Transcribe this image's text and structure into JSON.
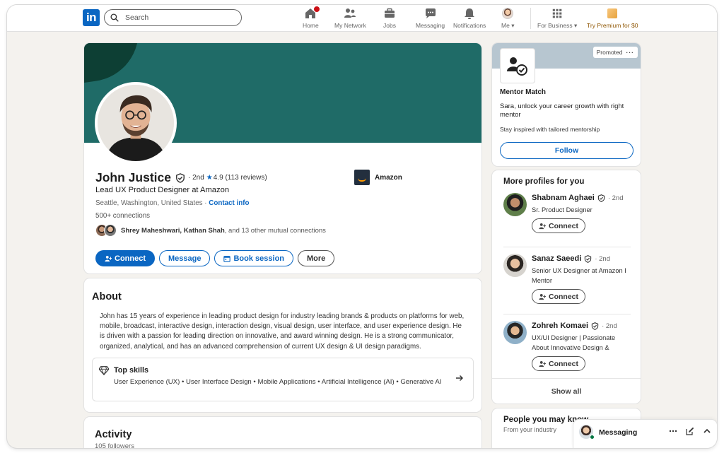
{
  "nav": {
    "search_placeholder": "Search",
    "items": [
      {
        "label": "Home",
        "icon": "home-icon"
      },
      {
        "label": "My Network",
        "icon": "network-icon"
      },
      {
        "label": "Jobs",
        "icon": "briefcase-icon"
      },
      {
        "label": "Messaging",
        "icon": "chat-icon"
      },
      {
        "label": "Notifications",
        "icon": "bell-icon"
      },
      {
        "label": "Me",
        "icon": "avatar"
      },
      {
        "label": "For Business",
        "icon": "grid-icon"
      },
      {
        "label": "Try Premium for $0",
        "icon": "premium-icon"
      }
    ]
  },
  "profile": {
    "name": "John Justice",
    "degree": "· 2nd",
    "rating": "4.9",
    "reviews": "(113 reviews)",
    "headline": "Lead UX Product Designer at Amazon",
    "location": "Seattle, Washington, United States ·",
    "contact_link": "Contact info",
    "connections": "500+ connections",
    "mutual_names": "Shrey Maheshwari, Kathan Shah",
    "mutual_rest": ", and 13 other mutual connections",
    "company": "Amazon",
    "buttons": {
      "connect": "Connect",
      "message": "Message",
      "book": "Book session",
      "more": "More"
    }
  },
  "about": {
    "title": "About",
    "text": "John has 15 years of experience in leading product design for industry leading brands & products on platforms for web, mobile, broadcast, interactive design, interaction design, visual design, user interface, and user experience design. He is driven with a passion for leading direction on innovative, and award winning design. He is a strong communicator, organized, analytical, and has an advanced comprehension of current UX design & UI design paradigms.",
    "skills_title": "Top skills",
    "skills": "User Experience (UX) • User Interface Design • Mobile Applications • Artificial Intelligence (AI) • Generative AI"
  },
  "activity": {
    "title": "Activity",
    "followers": "105 followers"
  },
  "ad": {
    "promoted": "Promoted",
    "name": "Mentor Match",
    "text": "Sara, unlock your career growth with right mentor",
    "sub": "Stay inspired with tailored mentorship",
    "follow": "Follow"
  },
  "more_profiles": {
    "title": "More profiles for you",
    "items": [
      {
        "name": "Shabnam Aghaei",
        "degree": "· 2nd",
        "headline": "Sr. Product Designer",
        "connect": "Connect"
      },
      {
        "name": "Sanaz Saeedi",
        "degree": "· 2nd",
        "headline": "Senior UX Designer at Amazon I Mentor",
        "connect": "Connect"
      },
      {
        "name": "Zohreh Komaei",
        "degree": "· 2nd",
        "headline": "UX/UI Designer | Passionate About Innovative Design &",
        "connect": "Connect"
      }
    ],
    "show_all": "Show all"
  },
  "pymk": {
    "title": "People you may know",
    "sub": "From your industry"
  },
  "messaging": {
    "label": "Messaging"
  },
  "colors": {
    "brand": "#0a66c2",
    "banner": "#1f6b67",
    "notification": "#cc1016",
    "online": "#057642"
  }
}
